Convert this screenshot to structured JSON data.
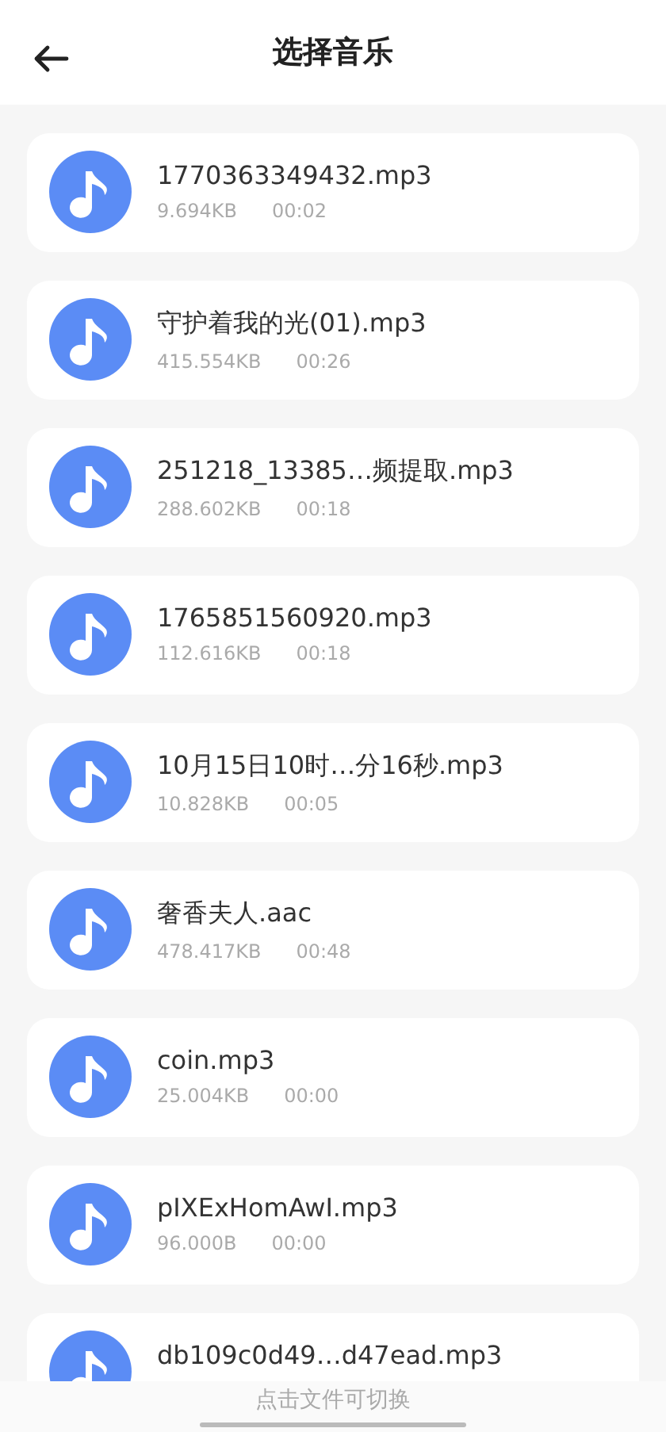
{
  "header": {
    "title": "选择音乐"
  },
  "files": [
    {
      "name": "1770363349432.mp3",
      "size": "9.694KB",
      "duration": "00:02"
    },
    {
      "name": "守护着我的光(01).mp3",
      "size": "415.554KB",
      "duration": "00:26"
    },
    {
      "name": "251218_13385…频提取.mp3",
      "size": "288.602KB",
      "duration": "00:18"
    },
    {
      "name": "1765851560920.mp3",
      "size": "112.616KB",
      "duration": "00:18"
    },
    {
      "name": "10月15日10时…分16秒.mp3",
      "size": "10.828KB",
      "duration": "00:05"
    },
    {
      "name": "奢香夫人.aac",
      "size": "478.417KB",
      "duration": "00:48"
    },
    {
      "name": "coin.mp3",
      "size": "25.004KB",
      "duration": "00:00"
    },
    {
      "name": "pIXExHomAwI.mp3",
      "size": "96.000B",
      "duration": "00:00"
    },
    {
      "name": "db109c0d49…d47ead.mp3"
    }
  ],
  "footer": {
    "hint": "点击文件可切换"
  }
}
